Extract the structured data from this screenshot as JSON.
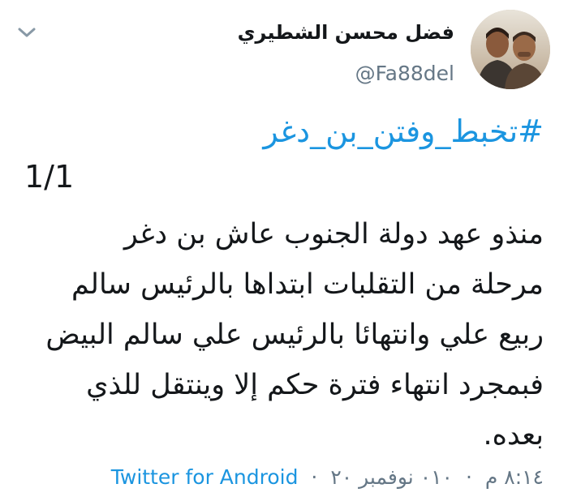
{
  "header": {
    "display_name": "فضل محسن الشطيري",
    "handle": "@Fa88del",
    "menu_icon": "chevron-down-icon",
    "avatar_icon": "profile-photo"
  },
  "tweet": {
    "hashtag": "#تخبط_وفتن_بن_دغر",
    "numbering": "1/1",
    "lines": [
      "منذو عهد دولة الجنوب عاش بن دغر",
      "مرحلة من التقلبات ابتداها بالرئيس سالم",
      "ربيع علي وانتهائا بالرئيس علي سالم البيض",
      "فبمجرد انتهاء فترة حكم إلا وينتقل للذي",
      "بعده."
    ]
  },
  "meta": {
    "time": "٨:١٤ م",
    "date": "٠١٠ نوفمبر ٢٠",
    "separator": "·",
    "source": "Twitter for Android"
  },
  "colors": {
    "link": "#1b95e0",
    "secondary": "#657786",
    "text": "#14171a"
  }
}
